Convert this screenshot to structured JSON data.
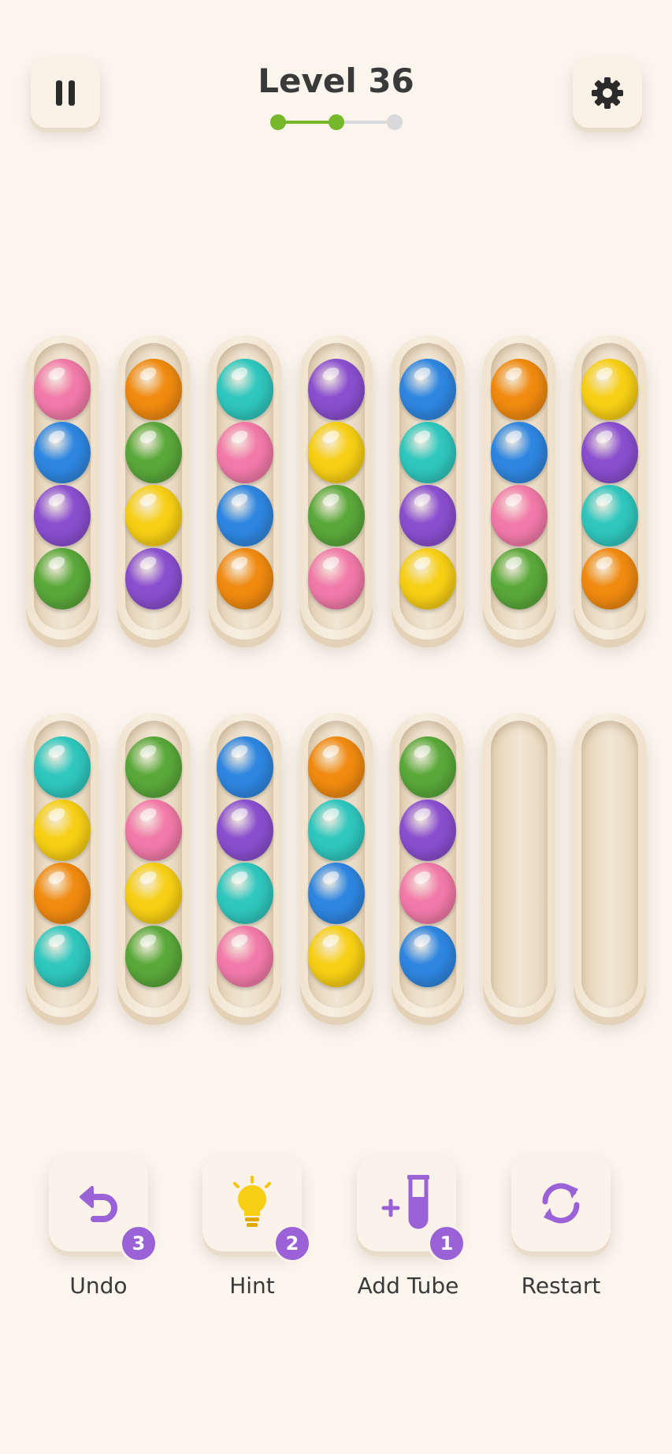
{
  "header": {
    "level_title": "Level 36",
    "progress": {
      "completed_steps": 2,
      "total_steps": 3
    }
  },
  "icons": {
    "pause": "pause-icon",
    "settings": "gear-icon",
    "undo": "undo-icon",
    "hint": "lightbulb-icon",
    "add_tube": "add-tube-icon",
    "restart": "restart-icon"
  },
  "colors": {
    "pink": "#f27aa8",
    "blue": "#2f86e0",
    "purple": "#8a4fcf",
    "green": "#5aa83a",
    "orange": "#f08a10",
    "teal": "#2fc7be",
    "yellow": "#f7cf15",
    "accent": "#9a62d6",
    "progress_done": "#76b82a",
    "progress_todo": "#d9d9d9"
  },
  "tubes": [
    [
      "pink",
      "blue",
      "purple",
      "green"
    ],
    [
      "orange",
      "green",
      "yellow",
      "purple"
    ],
    [
      "teal",
      "pink",
      "blue",
      "orange"
    ],
    [
      "purple",
      "yellow",
      "green",
      "pink"
    ],
    [
      "blue",
      "teal",
      "purple",
      "yellow"
    ],
    [
      "orange",
      "blue",
      "pink",
      "green"
    ],
    [
      "yellow",
      "purple",
      "teal",
      "orange"
    ],
    [
      "teal",
      "yellow",
      "orange",
      "teal"
    ],
    [
      "green",
      "pink",
      "yellow",
      "green"
    ],
    [
      "blue",
      "purple",
      "teal",
      "pink"
    ],
    [
      "orange",
      "teal",
      "blue",
      "yellow"
    ],
    [
      "green",
      "purple",
      "pink",
      "blue"
    ],
    [],
    []
  ],
  "actions": [
    {
      "label": "Undo",
      "count": "3"
    },
    {
      "label": "Hint",
      "count": "2"
    },
    {
      "label": "Add Tube",
      "count": "1"
    },
    {
      "label": "Restart"
    }
  ]
}
